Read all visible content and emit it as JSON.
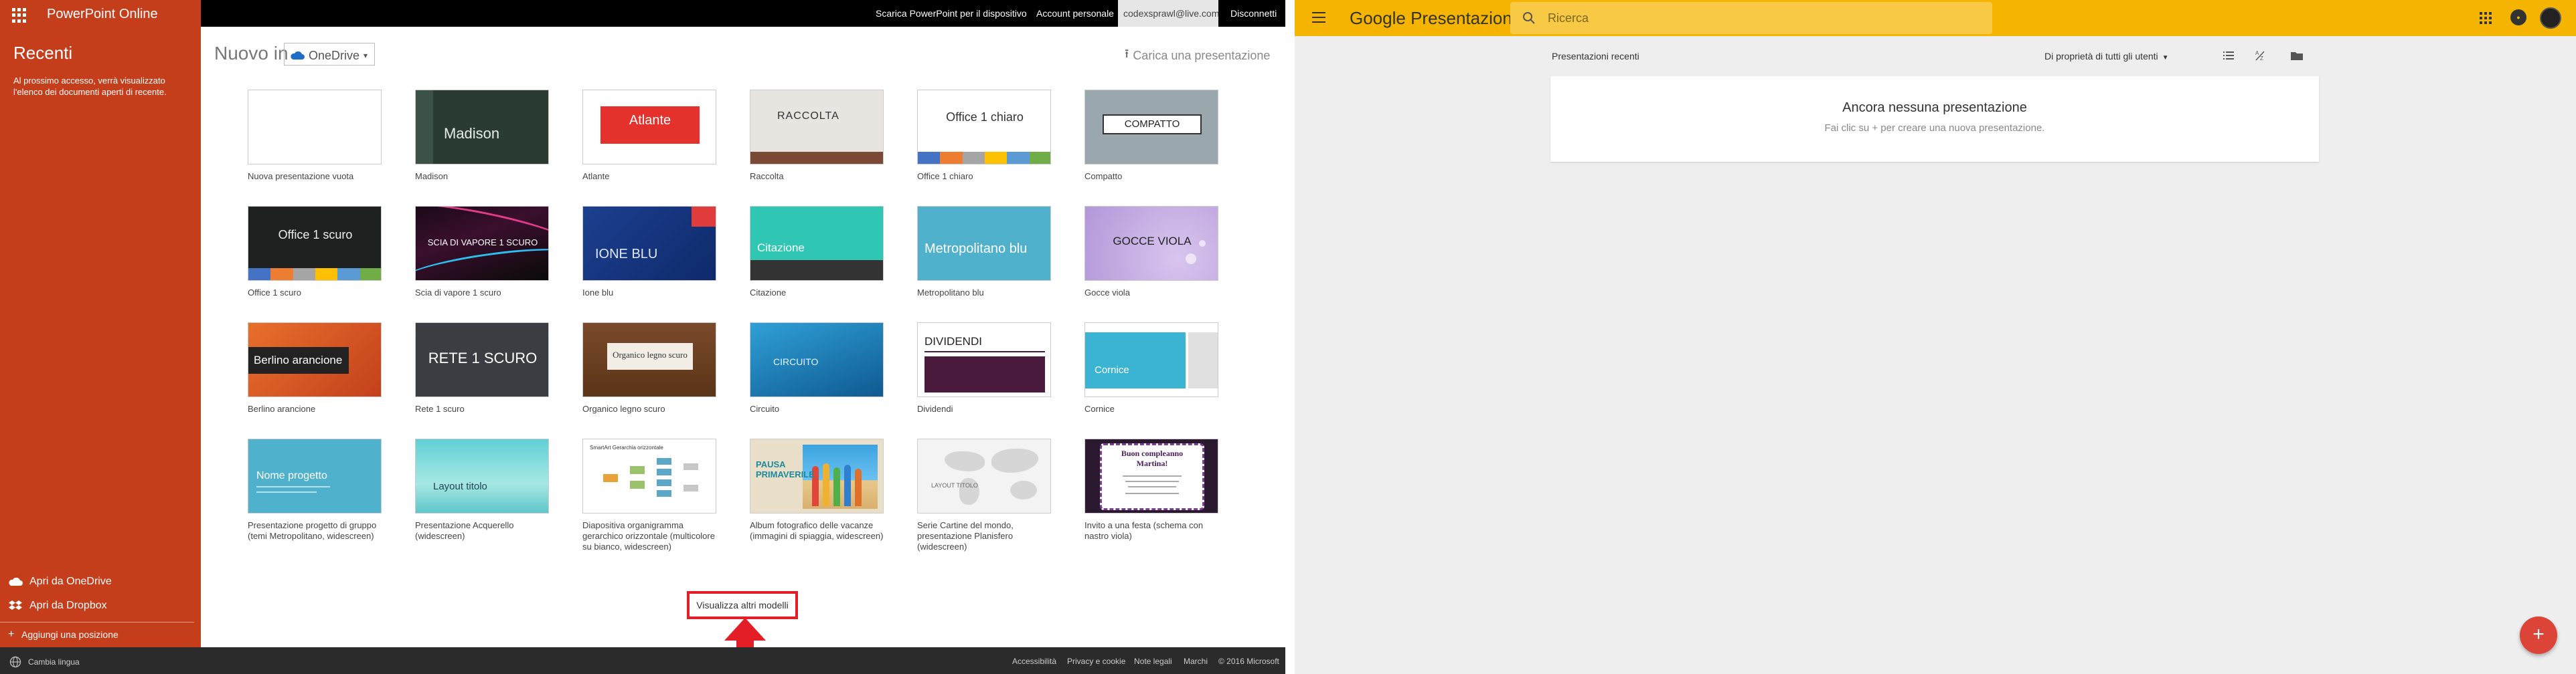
{
  "ppt": {
    "app_name": "PowerPoint Online",
    "sidebar": {
      "recent_title": "Recenti",
      "recent_desc": "Al prossimo accesso, verrà visualizzato l'elenco dei documenti aperti di recente.",
      "open_onedrive": "Apri da OneDrive",
      "open_dropbox": "Apri da Dropbox",
      "add_place": "Aggiungi una posizione"
    },
    "topbar": {
      "download": "Scarica PowerPoint per il dispositivo",
      "account": "Account personale",
      "email": "codexsprawl@live.com",
      "signout": "Disconnetti"
    },
    "header": {
      "new_in": "Nuovo in",
      "location": "OneDrive",
      "upload": "Carica una presentazione"
    },
    "templates": [
      {
        "label": "Nuova presentazione vuota",
        "thumb": "Nuova presentazione vuota"
      },
      {
        "label": "Madison",
        "thumb": "Madison"
      },
      {
        "label": "Atlante",
        "thumb": "Atlante"
      },
      {
        "label": "Raccolta",
        "thumb": "RACCOLTA"
      },
      {
        "label": "Office 1 chiaro",
        "thumb": "Office 1 chiaro"
      },
      {
        "label": "Compatto",
        "thumb": "COMPATTO"
      },
      {
        "label": "Office 1 scuro",
        "thumb": "Office 1 scuro"
      },
      {
        "label": "Scia di vapore 1 scuro",
        "thumb": "SCIA DI VAPORE 1 SCURO"
      },
      {
        "label": "Ione blu",
        "thumb": "IONE BLU"
      },
      {
        "label": "Citazione",
        "thumb": "Citazione"
      },
      {
        "label": "Metropolitano blu",
        "thumb": "Metropolitano blu"
      },
      {
        "label": "Gocce viola",
        "thumb": "GOCCE VIOLA"
      },
      {
        "label": "Berlino arancione",
        "thumb": "Berlino arancione"
      },
      {
        "label": "Rete 1 scuro",
        "thumb": "RETE 1 SCURO"
      },
      {
        "label": "Organico legno scuro",
        "thumb": "Organico legno scuro"
      },
      {
        "label": "Circuito",
        "thumb": "CIRCUITO"
      },
      {
        "label": "Dividendi",
        "thumb": "DIVIDENDI"
      },
      {
        "label": "Cornice",
        "thumb": "Cornice"
      },
      {
        "label": "Presentazione progetto di gruppo (temi Metropolitano, widescreen)",
        "thumb": "Nome progetto"
      },
      {
        "label": "Presentazione Acquerello (widescreen)",
        "thumb": "Layout titolo"
      },
      {
        "label": "Diapositiva organigramma gerarchico orizzontale (multicolore su bianco, widescreen)",
        "thumb": "SmartArt Gerarchia orizzontale"
      },
      {
        "label": "Album fotografico delle vacanze (immagini di spiaggia, widescreen)",
        "thumb": "PAUSA PRIMAVERILE"
      },
      {
        "label": "Serie Cartine del mondo, presentazione Planisfero (widescreen)",
        "thumb": "LAYOUT TITOLO"
      },
      {
        "label": "Invito a una festa (schema con nastro viola)",
        "thumb": "Buon compleanno Martina!"
      }
    ],
    "more_templates": "Visualizza altri modelli",
    "footer": {
      "language": "Cambia lingua",
      "accessibility": "Accessibilità",
      "privacy": "Privacy e cookie",
      "legal": "Note legali",
      "trademarks": "Marchi",
      "copyright": "© 2016 Microsoft"
    },
    "colors": {
      "sidebar": "#c43e1c",
      "highlight": "#e41e26"
    }
  },
  "gs": {
    "logo_google": "Google",
    "logo_product": "Presentazioni",
    "search_placeholder": "Ricerca",
    "recent_label": "Presentazioni recenti",
    "owner_filter": "Di proprietà di tutti gli utenti",
    "empty_title": "Ancora nessuna presentazione",
    "empty_sub": "Fai clic su + per creare una nuova presentazione.",
    "fab": "+",
    "colors": {
      "header": "#f4b400",
      "fab": "#db4437"
    }
  }
}
